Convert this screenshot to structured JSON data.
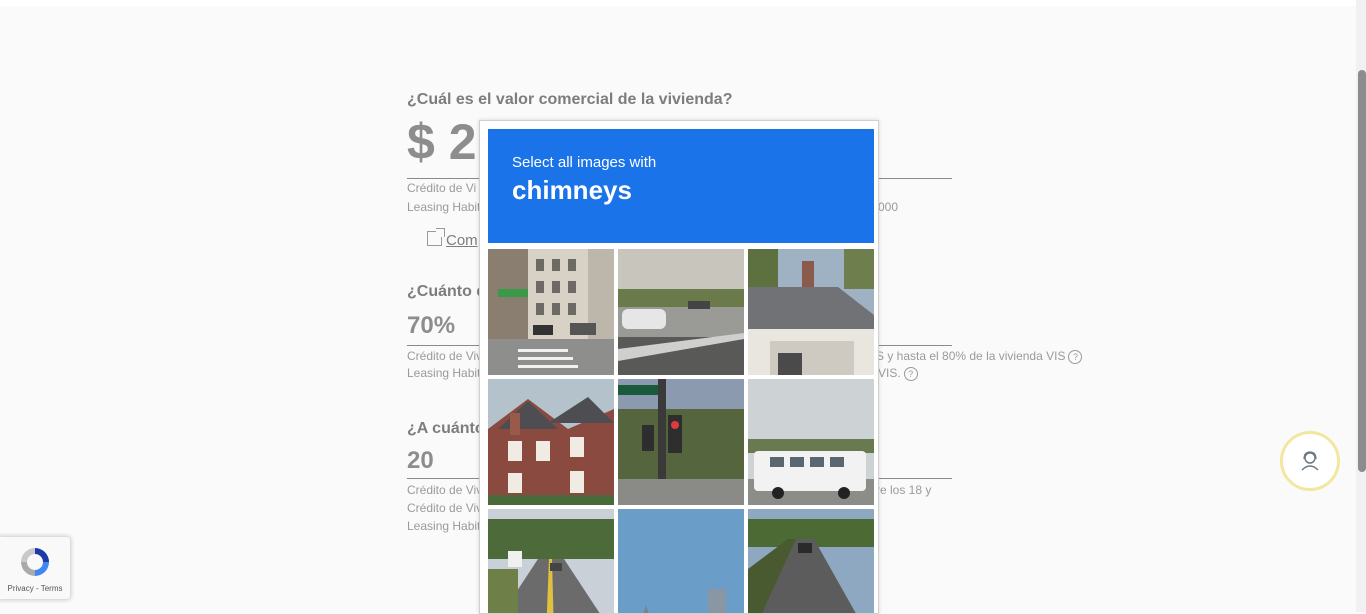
{
  "form": {
    "q1": {
      "question": "¿Cuál es el valor comercial de la vivienda?",
      "value": "$ 2",
      "note1": "Crédito de Vi",
      "note2": "Leasing Habit",
      "note2_right": "000"
    },
    "compare_link": "Com",
    "q2": {
      "question": "¿Cuánto d",
      "value": "70%",
      "note1": "Crédito de Viv",
      "note1_right": "S y hasta el 80% de la vivienda VIS",
      "note2": "Leasing Habit",
      "note2_right": "VIS."
    },
    "q3": {
      "question": "¿A cuánto",
      "value": "20",
      "note1": "Crédito de Viv",
      "note1_right": "re los 18 y",
      "note2": "Crédito de Viv",
      "note3": "Leasing Habit"
    },
    "help_glyph": "?"
  },
  "captcha": {
    "instruction": "Select all images with",
    "target": "chimneys",
    "tiles": [
      {
        "name": "city-street-buildings"
      },
      {
        "name": "road-parking-lot"
      },
      {
        "name": "house-roof-chimney"
      },
      {
        "name": "brick-house-chimney"
      },
      {
        "name": "traffic-light"
      },
      {
        "name": "white-bus"
      },
      {
        "name": "highway-cars"
      },
      {
        "name": "tall-building-sky"
      },
      {
        "name": "rural-road"
      }
    ]
  },
  "recaptcha": {
    "links": "Privacy - Terms"
  },
  "colors": {
    "captcha_header": "#1a73e8",
    "help_ring": "#f3e6a0"
  }
}
